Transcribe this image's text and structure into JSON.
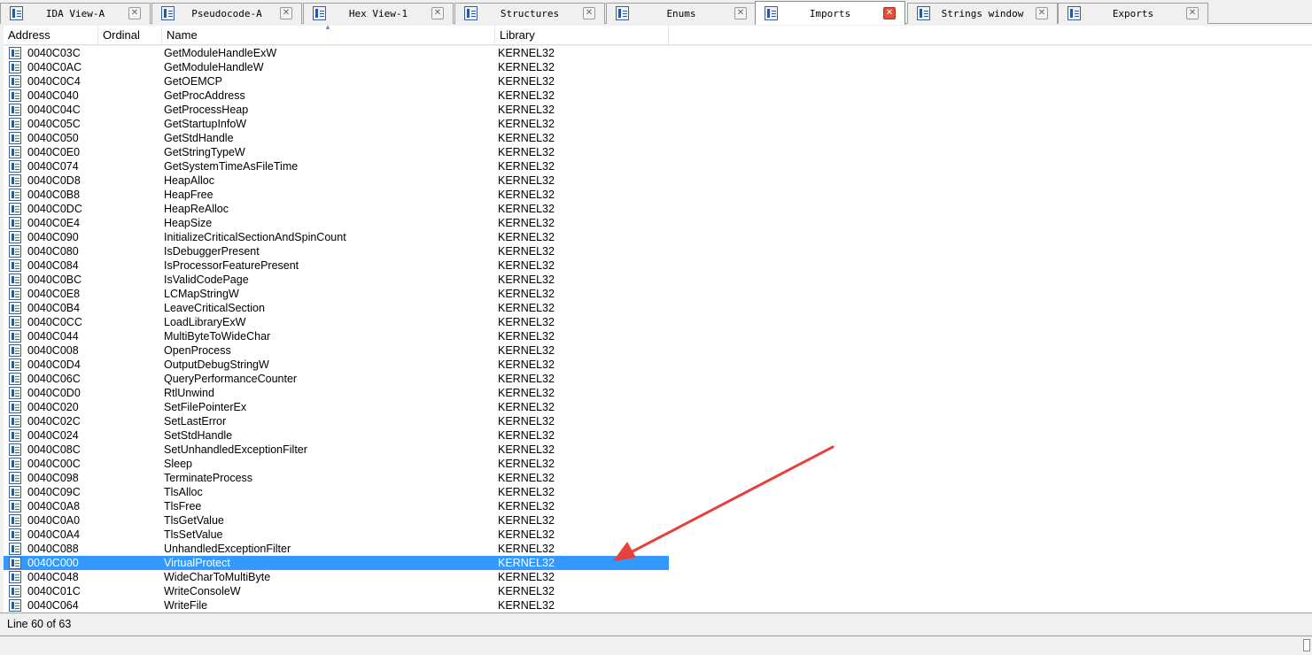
{
  "tabs": [
    {
      "label": "IDA View-A",
      "icon": "ida-view-icon",
      "active": false
    },
    {
      "label": "Pseudocode-A",
      "icon": "pseudocode-icon",
      "active": false
    },
    {
      "label": "Hex View-1",
      "icon": "hex-view-icon",
      "active": false
    },
    {
      "label": "Structures",
      "icon": "structures-icon",
      "active": false
    },
    {
      "label": "Enums",
      "icon": "enums-icon",
      "active": false
    },
    {
      "label": "Imports",
      "icon": "imports-icon",
      "active": true
    },
    {
      "label": "Strings window",
      "icon": "strings-icon",
      "active": false
    },
    {
      "label": "Exports",
      "icon": "exports-icon",
      "active": false
    }
  ],
  "close_glyph": "✕",
  "columns": {
    "address": "Address",
    "ordinal": "Ordinal",
    "name": "Name",
    "library": "Library"
  },
  "sort_glyph": "▲",
  "rows": [
    {
      "address": "0040C03C",
      "ordinal": "",
      "name": "GetModuleHandleExW",
      "library": "KERNEL32"
    },
    {
      "address": "0040C0AC",
      "ordinal": "",
      "name": "GetModuleHandleW",
      "library": "KERNEL32"
    },
    {
      "address": "0040C0C4",
      "ordinal": "",
      "name": "GetOEMCP",
      "library": "KERNEL32"
    },
    {
      "address": "0040C040",
      "ordinal": "",
      "name": "GetProcAddress",
      "library": "KERNEL32"
    },
    {
      "address": "0040C04C",
      "ordinal": "",
      "name": "GetProcessHeap",
      "library": "KERNEL32"
    },
    {
      "address": "0040C05C",
      "ordinal": "",
      "name": "GetStartupInfoW",
      "library": "KERNEL32"
    },
    {
      "address": "0040C050",
      "ordinal": "",
      "name": "GetStdHandle",
      "library": "KERNEL32"
    },
    {
      "address": "0040C0E0",
      "ordinal": "",
      "name": "GetStringTypeW",
      "library": "KERNEL32"
    },
    {
      "address": "0040C074",
      "ordinal": "",
      "name": "GetSystemTimeAsFileTime",
      "library": "KERNEL32"
    },
    {
      "address": "0040C0D8",
      "ordinal": "",
      "name": "HeapAlloc",
      "library": "KERNEL32"
    },
    {
      "address": "0040C0B8",
      "ordinal": "",
      "name": "HeapFree",
      "library": "KERNEL32"
    },
    {
      "address": "0040C0DC",
      "ordinal": "",
      "name": "HeapReAlloc",
      "library": "KERNEL32"
    },
    {
      "address": "0040C0E4",
      "ordinal": "",
      "name": "HeapSize",
      "library": "KERNEL32"
    },
    {
      "address": "0040C090",
      "ordinal": "",
      "name": "InitializeCriticalSectionAndSpinCount",
      "library": "KERNEL32"
    },
    {
      "address": "0040C080",
      "ordinal": "",
      "name": "IsDebuggerPresent",
      "library": "KERNEL32"
    },
    {
      "address": "0040C084",
      "ordinal": "",
      "name": "IsProcessorFeaturePresent",
      "library": "KERNEL32"
    },
    {
      "address": "0040C0BC",
      "ordinal": "",
      "name": "IsValidCodePage",
      "library": "KERNEL32"
    },
    {
      "address": "0040C0E8",
      "ordinal": "",
      "name": "LCMapStringW",
      "library": "KERNEL32"
    },
    {
      "address": "0040C0B4",
      "ordinal": "",
      "name": "LeaveCriticalSection",
      "library": "KERNEL32"
    },
    {
      "address": "0040C0CC",
      "ordinal": "",
      "name": "LoadLibraryExW",
      "library": "KERNEL32"
    },
    {
      "address": "0040C044",
      "ordinal": "",
      "name": "MultiByteToWideChar",
      "library": "KERNEL32"
    },
    {
      "address": "0040C008",
      "ordinal": "",
      "name": "OpenProcess",
      "library": "KERNEL32"
    },
    {
      "address": "0040C0D4",
      "ordinal": "",
      "name": "OutputDebugStringW",
      "library": "KERNEL32"
    },
    {
      "address": "0040C06C",
      "ordinal": "",
      "name": "QueryPerformanceCounter",
      "library": "KERNEL32"
    },
    {
      "address": "0040C0D0",
      "ordinal": "",
      "name": "RtlUnwind",
      "library": "KERNEL32"
    },
    {
      "address": "0040C020",
      "ordinal": "",
      "name": "SetFilePointerEx",
      "library": "KERNEL32"
    },
    {
      "address": "0040C02C",
      "ordinal": "",
      "name": "SetLastError",
      "library": "KERNEL32"
    },
    {
      "address": "0040C024",
      "ordinal": "",
      "name": "SetStdHandle",
      "library": "KERNEL32"
    },
    {
      "address": "0040C08C",
      "ordinal": "",
      "name": "SetUnhandledExceptionFilter",
      "library": "KERNEL32"
    },
    {
      "address": "0040C00C",
      "ordinal": "",
      "name": "Sleep",
      "library": "KERNEL32"
    },
    {
      "address": "0040C098",
      "ordinal": "",
      "name": "TerminateProcess",
      "library": "KERNEL32"
    },
    {
      "address": "0040C09C",
      "ordinal": "",
      "name": "TlsAlloc",
      "library": "KERNEL32"
    },
    {
      "address": "0040C0A8",
      "ordinal": "",
      "name": "TlsFree",
      "library": "KERNEL32"
    },
    {
      "address": "0040C0A0",
      "ordinal": "",
      "name": "TlsGetValue",
      "library": "KERNEL32"
    },
    {
      "address": "0040C0A4",
      "ordinal": "",
      "name": "TlsSetValue",
      "library": "KERNEL32"
    },
    {
      "address": "0040C088",
      "ordinal": "",
      "name": "UnhandledExceptionFilter",
      "library": "KERNEL32"
    },
    {
      "address": "0040C000",
      "ordinal": "",
      "name": "VirtualProtect",
      "library": "KERNEL32",
      "selected": true
    },
    {
      "address": "0040C048",
      "ordinal": "",
      "name": "WideCharToMultiByte",
      "library": "KERNEL32"
    },
    {
      "address": "0040C01C",
      "ordinal": "",
      "name": "WriteConsoleW",
      "library": "KERNEL32"
    },
    {
      "address": "0040C064",
      "ordinal": "",
      "name": "WriteFile",
      "library": "KERNEL32"
    }
  ],
  "status": {
    "text": "Line 60 of 63"
  },
  "colors": {
    "selection": "#3399ff",
    "annotation_arrow": "#e8403a"
  }
}
